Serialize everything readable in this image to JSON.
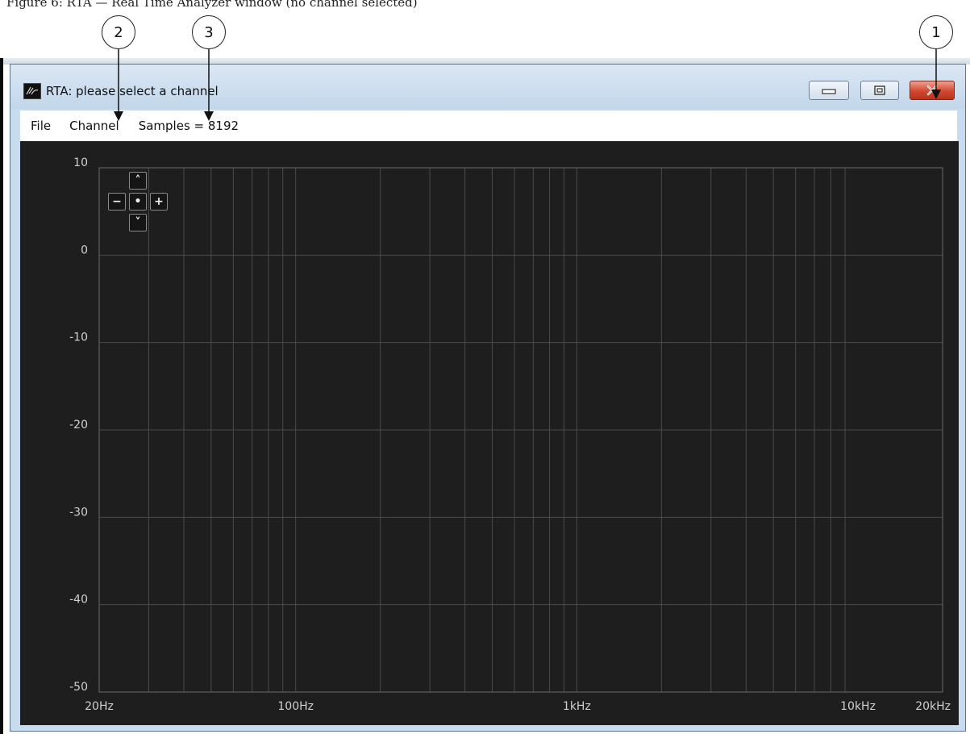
{
  "caption_fragment": "Figure 6: RTA — Real Time Analyzer window (no channel selected)",
  "callouts": [
    {
      "number": "2"
    },
    {
      "number": "3"
    },
    {
      "number": "1"
    }
  ],
  "window": {
    "title": "RTA: please select a channel",
    "caption_buttons": {
      "minimize": "minimize",
      "maximize": "maximize",
      "close": "close"
    }
  },
  "menu": {
    "file": "File",
    "channel": "Channel",
    "samples": "Samples = 8192"
  },
  "zoom_pad": {
    "up": "˄",
    "down": "˅",
    "minus": "−",
    "center": "•",
    "plus": "+"
  },
  "chart_data": {
    "type": "line",
    "title": "",
    "xlabel": "",
    "ylabel": "",
    "x_scale": "log",
    "xlim": [
      20,
      20000
    ],
    "ylim": [
      -50,
      10
    ],
    "y_ticks": [
      10,
      0,
      -10,
      -20,
      -30,
      -40,
      -50
    ],
    "y_tick_labels": [
      "10",
      "0",
      "-10",
      "-20",
      "-30",
      "-40",
      "-50"
    ],
    "x_tick_labels": [
      {
        "value": 20,
        "label": "20Hz"
      },
      {
        "value": 100,
        "label": "100Hz"
      },
      {
        "value": 1000,
        "label": "1kHz"
      },
      {
        "value": 10000,
        "label": "10kHz"
      },
      {
        "value": 20000,
        "label": "20kHz"
      }
    ],
    "x_gridlines": [
      30,
      40,
      50,
      60,
      70,
      80,
      90,
      100,
      200,
      300,
      400,
      500,
      600,
      700,
      800,
      900,
      1000,
      2000,
      3000,
      4000,
      5000,
      6000,
      7000,
      8000,
      9000
    ],
    "series": [],
    "grid": true,
    "colors": {
      "background": "#1e1e1e",
      "grid": "#4a4a4a",
      "frame": "#6a6a6a",
      "tick_text": "#d0d0d0"
    }
  }
}
